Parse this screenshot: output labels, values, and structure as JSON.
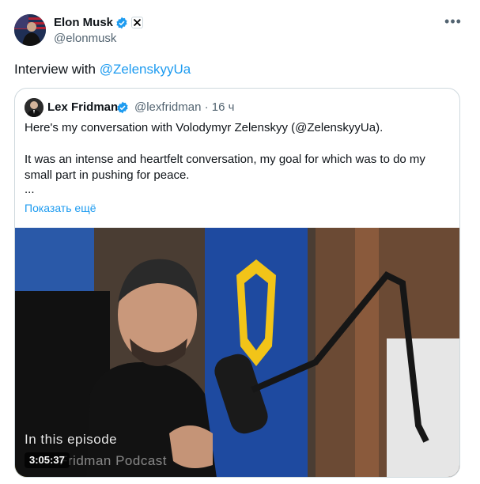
{
  "post": {
    "author_name": "Elon Musk",
    "author_handle": "@elonmusk",
    "more_icon": "more-horizontal-icon",
    "text_prefix": "Interview with ",
    "text_mention": "@ZelenskyyUa"
  },
  "quote": {
    "author_name": "Lex Fridman",
    "author_handle": "@lexfridman · 16 ч",
    "line1": "Here's my conversation with Volodymyr Zelenskyy (@ZelenskyyUa).",
    "line2": "It was an intense and heartfelt conversation, my goal for which was to do my small part in pushing for peace.",
    "line3": "...",
    "show_more": "Показать ещё"
  },
  "video": {
    "episode_text": "In this episode",
    "watermark": "Fridman Podcast",
    "duration": "3:05:37"
  },
  "colors": {
    "link": "#1d9bf0",
    "verified": "#1d9bf0",
    "secondary_text": "#536471",
    "border": "#cfd9de"
  }
}
